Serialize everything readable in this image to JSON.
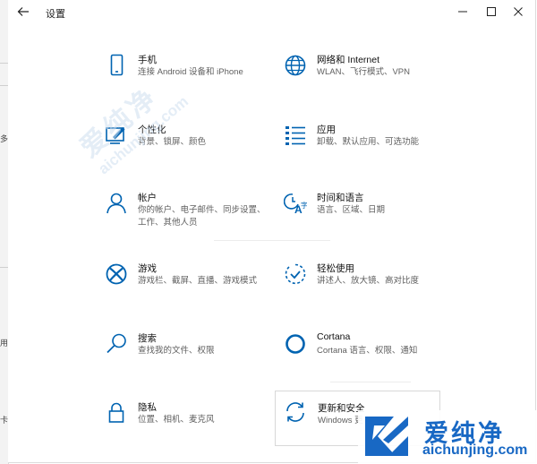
{
  "window": {
    "title": "设置"
  },
  "tiles": [
    {
      "key": "phone",
      "name": "手机",
      "desc": "连接 Android 设备和 iPhone",
      "icon": "phone-icon"
    },
    {
      "key": "network",
      "name": "网络和 Internet",
      "desc": "WLAN、飞行模式、VPN",
      "icon": "globe-icon"
    },
    {
      "key": "personalize",
      "name": "个性化",
      "desc": "背景、锁屏、颜色",
      "icon": "paint-icon"
    },
    {
      "key": "apps",
      "name": "应用",
      "desc": "卸载、默认应用、可选功能",
      "icon": "apps-list-icon"
    },
    {
      "key": "accounts",
      "name": "帐户",
      "desc": "你的帐户、电子邮件、同步设置、工作、其他人员",
      "icon": "person-icon"
    },
    {
      "key": "time",
      "name": "时间和语言",
      "desc": "语言、区域、日期",
      "icon": "time-language-icon"
    },
    {
      "key": "gaming",
      "name": "游戏",
      "desc": "游戏栏、截屏、直播、游戏模式",
      "icon": "xbox-icon"
    },
    {
      "key": "ease",
      "name": "轻松使用",
      "desc": "讲述人、放大镜、高对比度",
      "icon": "ease-of-access-icon"
    },
    {
      "key": "search",
      "name": "搜索",
      "desc": "查找我的文件、权限",
      "icon": "search-icon"
    },
    {
      "key": "cortana",
      "name": "Cortana",
      "desc": "Cortana 语言、权限、通知",
      "icon": "cortana-icon"
    },
    {
      "key": "privacy",
      "name": "隐私",
      "desc": "位置、相机、麦克风",
      "icon": "lock-icon"
    },
    {
      "key": "update",
      "name": "更新和安全",
      "desc": "Windows 更",
      "icon": "refresh-icon"
    }
  ],
  "background_window": {
    "fragments": [
      "多",
      "用",
      "卡"
    ]
  },
  "watermark": {
    "text": "爱纯净",
    "url": "aichunjing.com"
  },
  "colors": {
    "accent": "#0063b1",
    "watermark_blue": "#1868c4"
  }
}
